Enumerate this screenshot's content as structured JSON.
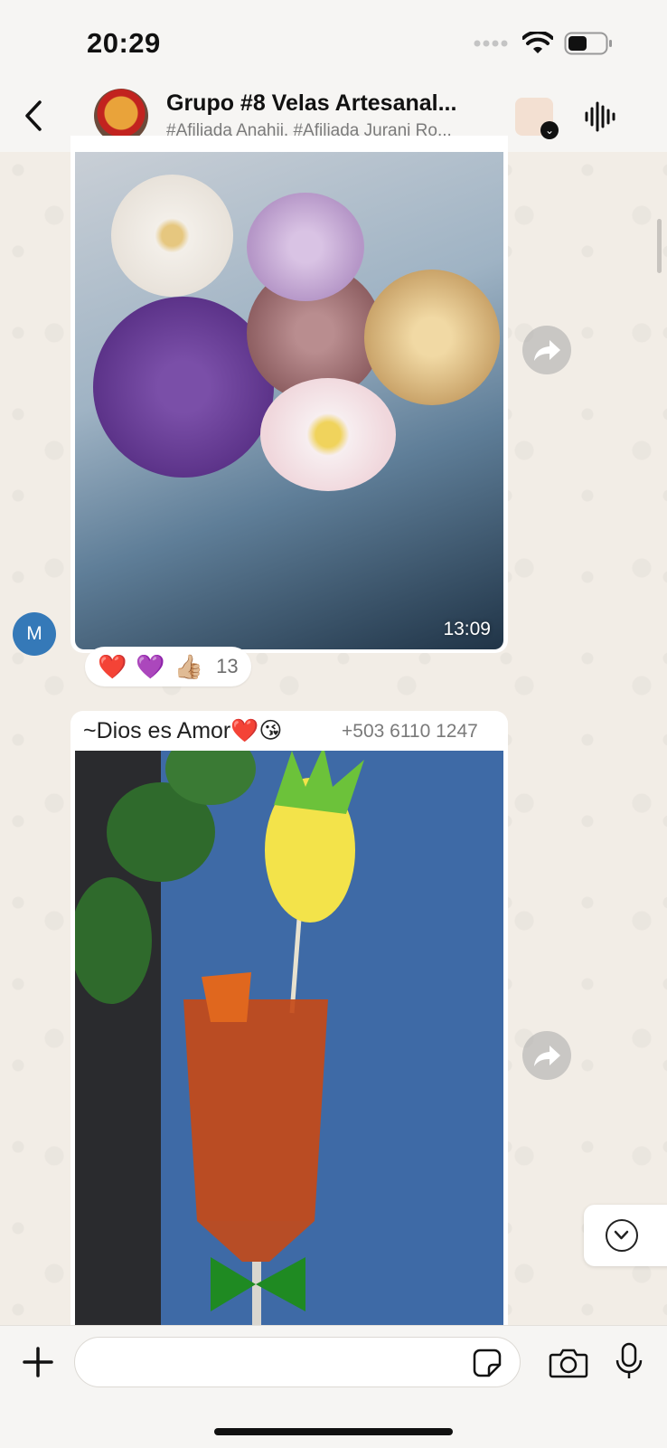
{
  "status_bar": {
    "time": "20:29"
  },
  "header": {
    "title": "Grupo #8 Velas Artesanal...",
    "subtitle": "#Afiliada Anahii, #Afiliada Jurani Ro..."
  },
  "messages": [
    {
      "type": "image",
      "timestamp": "13:09",
      "sender_initial": "M",
      "reactions": {
        "emojis": [
          "❤️",
          "💜",
          "👍🏼"
        ],
        "count": "13"
      }
    },
    {
      "type": "image",
      "sender_name": "~Dios es Amor❤️😘",
      "sender_phone": "+503 6110 1247"
    }
  ],
  "colors": {
    "accent_avatar": "#3579b8",
    "chat_background": "#f2ede6"
  },
  "icons": {
    "back": "chevron-left-icon",
    "voice_call": "waveform-icon",
    "forward": "forward-icon",
    "scroll_down": "chevron-down-icon",
    "add": "plus-icon",
    "sticker": "sticker-icon",
    "camera": "camera-icon",
    "mic": "mic-icon"
  }
}
